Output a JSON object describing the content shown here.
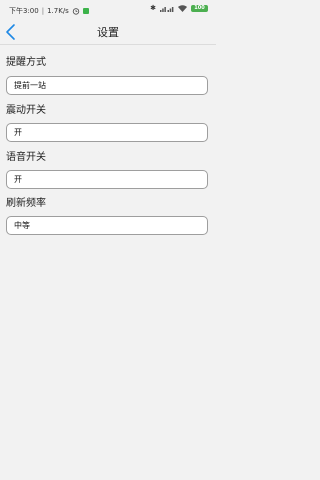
{
  "status_bar": {
    "time": "下午3:00",
    "network_speed": "1.7K/s",
    "battery": "100",
    "icons": [
      "alarm-icon",
      "app-notification-icon",
      "bluetooth-icon",
      "signal-icon",
      "wifi-icon",
      "battery-icon"
    ]
  },
  "header": {
    "title": "设置",
    "back_icon": "chevron-left-icon",
    "accent_color": "#1e88e5"
  },
  "settings": [
    {
      "label": "提醒方式",
      "value": "提前一站"
    },
    {
      "label": "震动开关",
      "value": "开"
    },
    {
      "label": "语音开关",
      "value": "开"
    },
    {
      "label": "刷新频率",
      "value": "中等"
    }
  ]
}
